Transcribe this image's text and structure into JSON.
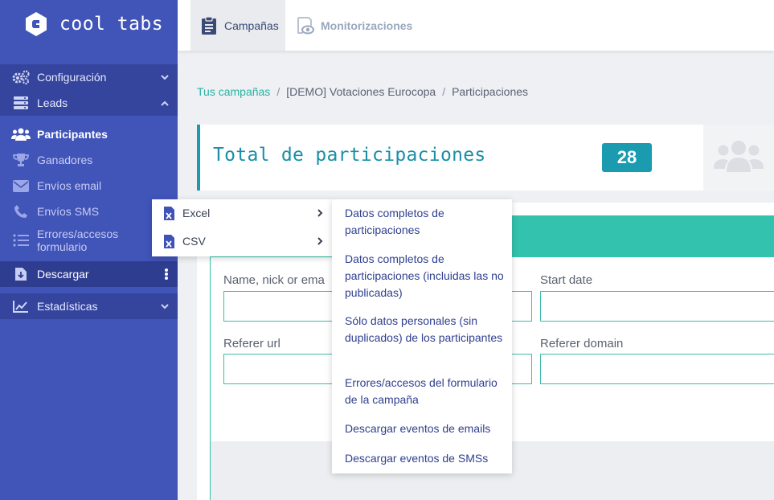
{
  "brand": {
    "name": "cool tabs"
  },
  "sidebar": {
    "configuracion": "Configuración",
    "leads": "Leads",
    "sub": {
      "participantes": "Participantes",
      "ganadores": "Ganadores",
      "envios_email": "Envíos email",
      "envios_sms": "Envíos SMS",
      "errores_line1": "Errores/accesos",
      "errores_line2": "formulario"
    },
    "descargar": "Descargar",
    "estadisticas": "Estadísticas"
  },
  "topbar": {
    "tabs": [
      {
        "label": "Campañas",
        "active": true
      },
      {
        "label": "Monitorizaciones",
        "active": false
      }
    ]
  },
  "breadcrumb": {
    "items": [
      "Tus campañas",
      "[DEMO] Votaciones Eurocopa",
      "Participaciones"
    ],
    "separator": "/"
  },
  "total": {
    "title": "Total de participaciones",
    "count": "28"
  },
  "filters": {
    "name_label": "Name, nick or ema",
    "start_date_label": "Start date",
    "referer_url_label": "Referer url",
    "referer_domain_label": "Referer domain"
  },
  "menu_formats": {
    "items": [
      "Excel",
      "CSV"
    ]
  },
  "menu_options": {
    "items": [
      "Datos completos de participaciones",
      "Datos completos de participaciones (incluidas las no publicadas)",
      "Sólo datos personales (sin duplicados) de los participantes",
      "Errores/accesos del formulario de la campaña",
      "Descargar eventos de emails",
      "Descargar eventos de SMSs"
    ]
  },
  "colors": {
    "sidebar": "#4154b8",
    "sidebar_dark": "#35449d",
    "accent_teal": "#33c2ad",
    "accent_blue": "#1a9bb0"
  }
}
